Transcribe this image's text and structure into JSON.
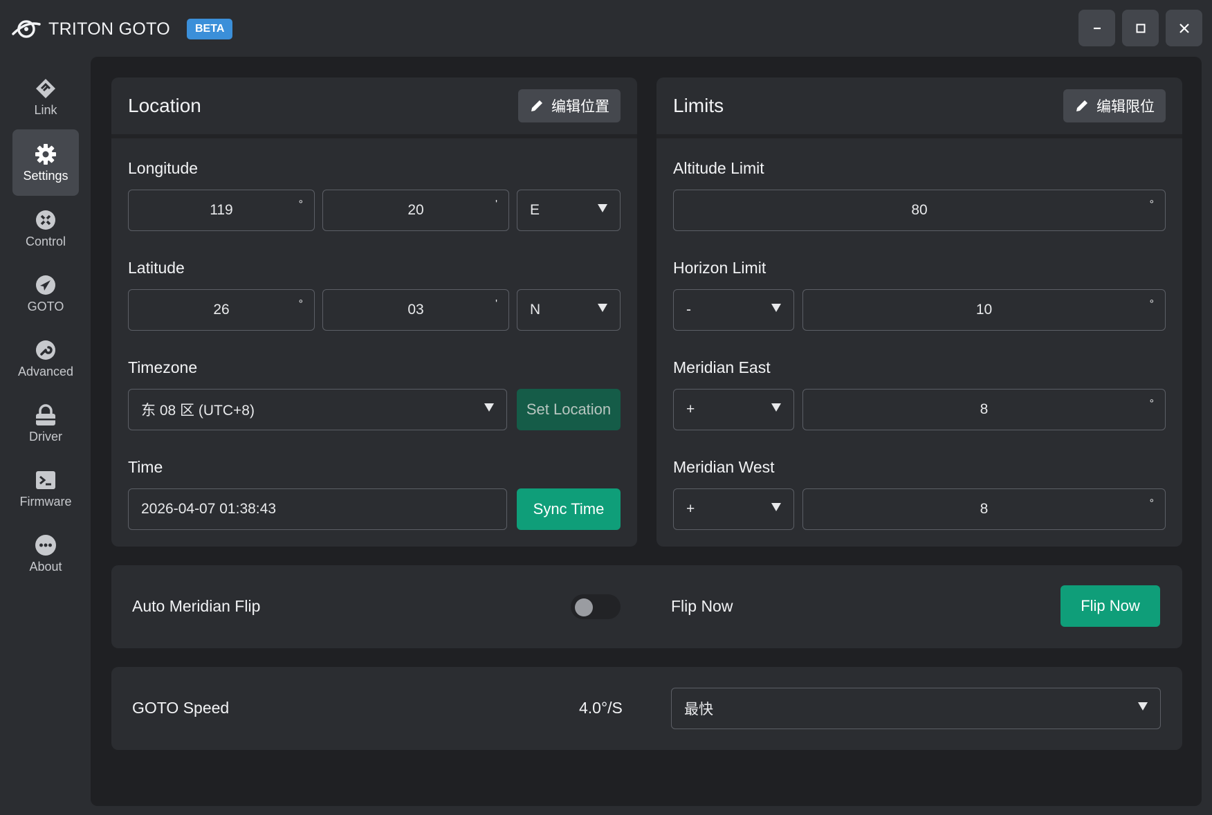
{
  "app": {
    "title": "TRITON GOTO",
    "badge": "BETA"
  },
  "window_controls": [
    "minimize-icon",
    "maximize-icon",
    "close-icon"
  ],
  "sidebar": {
    "items": [
      {
        "label": "Link",
        "icon": "link-icon",
        "active": false
      },
      {
        "label": "Settings",
        "icon": "gear-icon",
        "active": true
      },
      {
        "label": "Control",
        "icon": "control-icon",
        "active": false
      },
      {
        "label": "GOTO",
        "icon": "navigation-arrow-icon",
        "active": false
      },
      {
        "label": "Advanced",
        "icon": "wrench-icon",
        "active": false
      },
      {
        "label": "Driver",
        "icon": "lock-icon",
        "active": false
      },
      {
        "label": "Firmware",
        "icon": "terminal-icon",
        "active": false
      },
      {
        "label": "About",
        "icon": "more-dots-icon",
        "active": false
      }
    ]
  },
  "location": {
    "title": "Location",
    "edit_label": "编辑位置",
    "longitude": {
      "label": "Longitude",
      "degrees": "119",
      "degrees_unit": "°",
      "minutes": "20",
      "minutes_unit": "'",
      "direction": "E"
    },
    "latitude": {
      "label": "Latitude",
      "degrees": "26",
      "degrees_unit": "°",
      "minutes": "03",
      "minutes_unit": "'",
      "direction": "N"
    },
    "timezone": {
      "label": "Timezone",
      "value": "东 08 区 (UTC+8)",
      "set_label": "Set Location"
    },
    "time": {
      "label": "Time",
      "value": "2026-04-07  01:38:43",
      "sync_label": "Sync Time"
    }
  },
  "limits": {
    "title": "Limits",
    "edit_label": "编辑限位",
    "altitude": {
      "label": "Altitude Limit",
      "value": "80",
      "unit": "°"
    },
    "horizon": {
      "label": "Horizon Limit",
      "sign": "-",
      "value": "10",
      "unit": "°"
    },
    "meridian_east": {
      "label": "Meridian East",
      "sign": "+",
      "value": "8",
      "unit": "°"
    },
    "meridian_west": {
      "label": "Meridian West",
      "sign": "+",
      "value": "8",
      "unit": "°"
    }
  },
  "flip": {
    "auto_label": "Auto Meridian Flip",
    "auto_enabled": false,
    "flip_now_label": "Flip Now",
    "flip_now_button": "Flip Now"
  },
  "speed": {
    "label": "GOTO Speed",
    "value": "4.0°/S",
    "selected": "最快"
  },
  "colors": {
    "accent": "#0f9e79",
    "beta": "#3b8fd9",
    "background": "#2b2d31",
    "panel": "#1f2023"
  }
}
